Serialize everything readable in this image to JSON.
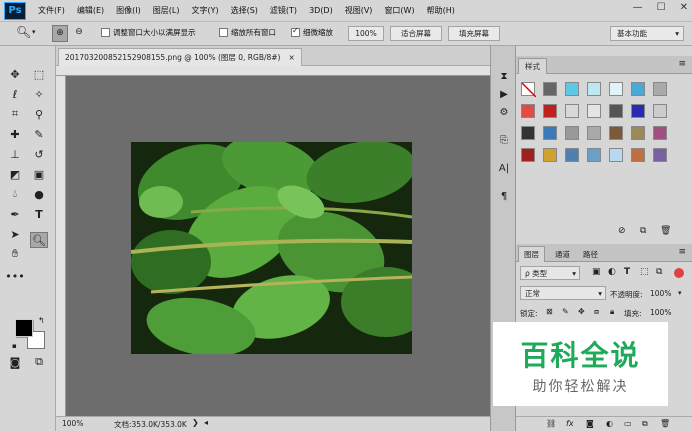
{
  "app": {
    "logo": "Ps"
  },
  "menu": [
    "文件(F)",
    "编辑(E)",
    "图像(I)",
    "图层(L)",
    "文字(Y)",
    "选择(S)",
    "滤镜(T)",
    "3D(D)",
    "视图(V)",
    "窗口(W)",
    "帮助(H)"
  ],
  "window_controls": {
    "minimize": "—",
    "maximize": "☐",
    "close": "✕"
  },
  "options": {
    "resize_windows_label": "调整窗口大小以满屏显示",
    "zoom_all_label": "缩放所有窗口",
    "scrubby_zoom_label": "细微缩放",
    "zoom_value": "100%",
    "fit_screen": "适合屏幕",
    "fill_screen": "填充屏幕",
    "workspace": "基本功能",
    "resize_windows_checked": false,
    "zoom_all_checked": false,
    "scrubby_zoom_checked": true
  },
  "document": {
    "tab_title": "20170320085215290815​5.png @ 100% (图层 0, RGB/8#)",
    "close": "×"
  },
  "status": {
    "zoom": "100%",
    "doc_info": "文档:353.0K/353.0K"
  },
  "styles_panel": {
    "tab": "样式"
  },
  "layers_panel": {
    "tabs": [
      "图层",
      "通道",
      "路径"
    ],
    "kind_label": "ρ 类型",
    "blend_mode": "正常",
    "opacity_label": "不透明度:",
    "opacity_value": "100%",
    "lock_label": "锁定:",
    "fill_label": "填充:",
    "fill_value": "100%"
  },
  "watermark": {
    "title": "百科全说",
    "subtitle": "助你轻松解决"
  },
  "colors": {
    "foreground": "#000000",
    "background": "#ffffff",
    "ui_bg": "#d6d6d6",
    "canvas_bg": "#6d6d6d",
    "watermark_green": "#1eaa5a"
  }
}
